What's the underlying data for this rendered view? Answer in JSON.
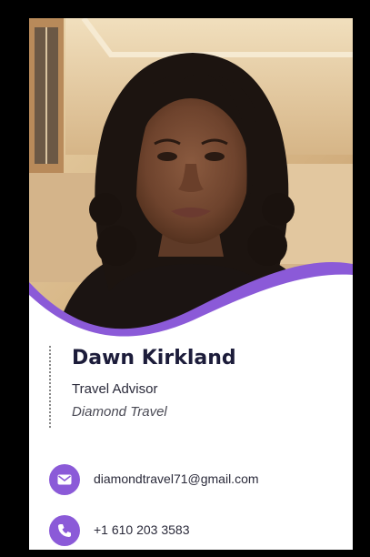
{
  "card": {
    "name": "Dawn Kirkland",
    "role": "Travel Advisor",
    "company": "Diamond Travel"
  },
  "contacts": {
    "email": {
      "icon": "envelope-icon",
      "text": "diamondtravel71@gmail.com"
    },
    "phone": {
      "icon": "phone-icon",
      "text": "+1 610 203 3583"
    }
  },
  "colors": {
    "accent": "#8b5ad8",
    "name_text": "#1c1c3a",
    "page_background": "#000000",
    "card_background": "#ffffff"
  }
}
